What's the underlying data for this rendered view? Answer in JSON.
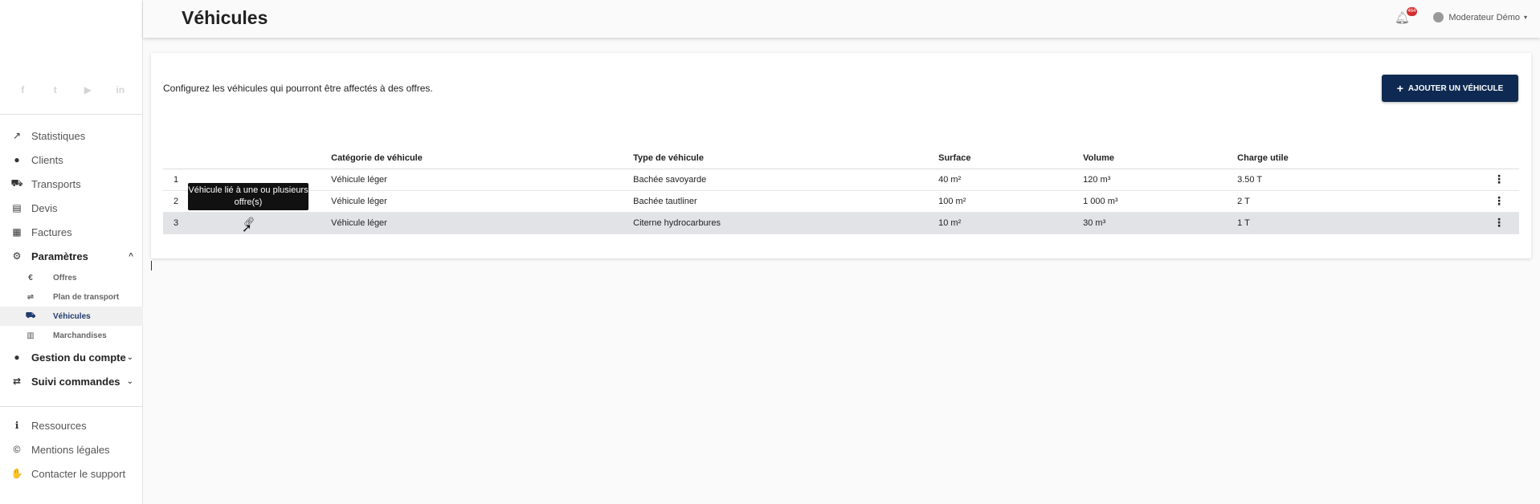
{
  "sidebar": {
    "social": [
      "f",
      "t",
      "▶",
      "in"
    ],
    "items": [
      {
        "icon": "chart-line-icon",
        "glyph": "↗",
        "label": "Statistiques"
      },
      {
        "icon": "user-icon",
        "glyph": "●",
        "label": "Clients"
      },
      {
        "icon": "truck-icon",
        "glyph": "⛟",
        "label": "Transports"
      },
      {
        "icon": "file-invoice-icon",
        "glyph": "▤",
        "label": "Devis"
      },
      {
        "icon": "receipt-icon",
        "glyph": "▦",
        "label": "Factures"
      },
      {
        "icon": "cogs-icon",
        "glyph": "⚙",
        "label": "Paramètres",
        "chevron": "^"
      }
    ],
    "sub_items": [
      {
        "icon": "euro-icon",
        "glyph": "€",
        "label": "Offres"
      },
      {
        "icon": "signs-icon",
        "glyph": "⇌",
        "label": "Plan de transport"
      },
      {
        "icon": "truck-icon",
        "glyph": "⛟",
        "label": "Véhicules"
      },
      {
        "icon": "boxes-icon",
        "glyph": "▥",
        "label": "Marchandises"
      }
    ],
    "items2": [
      {
        "icon": "user-cog-icon",
        "glyph": "●",
        "label": "Gestion du compte",
        "chevron": "⌄"
      },
      {
        "icon": "exchange-icon",
        "glyph": "⇄",
        "label": "Suivi commandes",
        "chevron": "⌄"
      }
    ],
    "footer": [
      {
        "icon": "info-circle-icon",
        "glyph": "ℹ",
        "label": "Ressources"
      },
      {
        "icon": "copyright-icon",
        "glyph": "©",
        "label": "Mentions légales"
      },
      {
        "icon": "handshake-icon",
        "glyph": "✋",
        "label": "Contacter le support"
      }
    ]
  },
  "header": {
    "title": "Véhicules",
    "notification_count": "464",
    "user_name": "Moderateur Démo"
  },
  "main": {
    "intro": "Configurez les véhicules qui pourront être affectés à des offres.",
    "add_button": "AJOUTER UN VÉHICULE",
    "columns": [
      "",
      "",
      "Catégorie de véhicule",
      "Type de véhicule",
      "Surface",
      "Volume",
      "Charge utile",
      ""
    ],
    "rows": [
      {
        "num": "1",
        "categorie": "Véhicule léger",
        "type": "Bachée savoyarde",
        "surface": "40 m²",
        "volume": "120 m³",
        "charge": "3.50 T"
      },
      {
        "num": "2",
        "categorie": "Véhicule léger",
        "type": "Bachée tautliner",
        "surface": "100 m²",
        "volume": "1 000 m³",
        "charge": "2 T"
      },
      {
        "num": "3",
        "categorie": "Véhicule léger",
        "type": "Citerne hydrocarbures",
        "surface": "10 m²",
        "volume": "30 m³",
        "charge": "1 T"
      }
    ],
    "tooltip": "Véhicule lié à une ou plusieurs offre(s)",
    "row_menu_glyph": "⋮"
  },
  "colors": {
    "accent": "#0f2a52",
    "active_text": "#1f3a6b",
    "badge": "#d32f2f",
    "highlight_row": "#e1e3e6"
  }
}
